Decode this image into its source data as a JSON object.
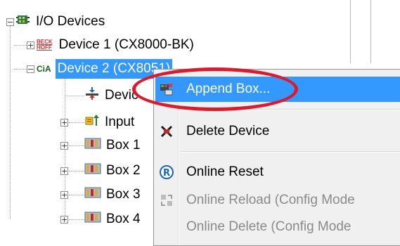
{
  "tree": {
    "root": {
      "label": "I/O Devices",
      "expanded": true,
      "icon": "io-devices-icon"
    },
    "device1": {
      "label": "Device 1 (CX8000-BK)",
      "logo_line1": "BECK",
      "logo_line2": "HOFF",
      "icon": "beckhoff-logo-icon"
    },
    "device2": {
      "label": "Device 2 (CX8051)",
      "logo": "CiA",
      "icon": "cia-logo-icon"
    },
    "children": [
      {
        "label": "Devic",
        "icon": "device-connector-icon"
      },
      {
        "label": "Input",
        "icon": "inputs-icon"
      },
      {
        "label": "Box 1",
        "icon": "box-icon"
      },
      {
        "label": "Box 2",
        "icon": "box-icon"
      },
      {
        "label": "Box 3",
        "icon": "box-icon"
      },
      {
        "label": "Box 4",
        "icon": "box-icon"
      }
    ]
  },
  "context_menu": {
    "items": [
      {
        "label": "Append Box...",
        "icon": "append-box-icon",
        "highlighted": true
      },
      {
        "label": "Delete Device",
        "icon": "delete-device-icon"
      },
      {
        "label": "Online Reset",
        "icon": "online-reset-icon"
      },
      {
        "label": "Online Reload (Config Mode",
        "icon": "online-reload-icon",
        "disabled": true
      },
      {
        "label": "Online Delete (Config Mode",
        "disabled": true
      }
    ]
  },
  "colors": {
    "selection": "#3399ff",
    "callout": "#e0182b",
    "menu_bg": "#f0f0f0"
  }
}
